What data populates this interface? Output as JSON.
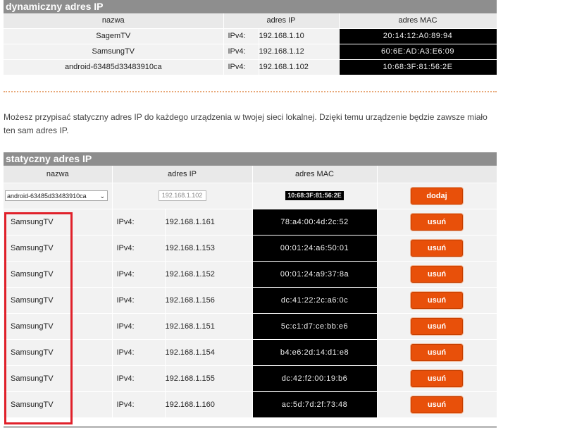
{
  "dynamic": {
    "title": "dynamiczny adres IP",
    "headers": {
      "name": "nazwa",
      "ip": "adres IP",
      "mac": "adres MAC"
    },
    "rows": [
      {
        "name": "SagemTV",
        "proto": "IPv4:",
        "ip": "192.168.1.10",
        "mac": "20:14:12:A0:89:94"
      },
      {
        "name": "SamsungTV",
        "proto": "IPv4:",
        "ip": "192.168.1.12",
        "mac": "60:6E:AD:A3:E6:09"
      },
      {
        "name": "android-63485d33483910ca",
        "proto": "IPv4:",
        "ip": "192.168.1.102",
        "mac": "10:68:3F:81:56:2E"
      }
    ]
  },
  "intro_text": "Możesz przypisać statyczny adres IP do każdego urządzenia w twojej sieci lokalnej. Dzięki temu urządzenie będzie zawsze miało ten sam adres IP.",
  "static": {
    "title": "statyczny adres IP",
    "headers": {
      "name": "nazwa",
      "ip": "adres IP",
      "mac": "adres MAC"
    },
    "add_row": {
      "device_select": "android-63485d33483910ca",
      "ip_value": "192.168.1.102",
      "mac": "10:68:3F:81:56:2E",
      "add_label": "dodaj"
    },
    "remove_label": "usuń",
    "rows": [
      {
        "name": "SamsungTV",
        "proto": "IPv4:",
        "ip": "192.168.1.161",
        "mac": "78:a4:00:4d:2c:52"
      },
      {
        "name": "SamsungTV",
        "proto": "IPv4:",
        "ip": "192.168.1.153",
        "mac": "00:01:24:a6:50:01"
      },
      {
        "name": "SamsungTV",
        "proto": "IPv4:",
        "ip": "192.168.1.152",
        "mac": "00:01:24:a9:37:8a"
      },
      {
        "name": "SamsungTV",
        "proto": "IPv4:",
        "ip": "192.168.1.156",
        "mac": "dc:41:22:2c:a6:0c"
      },
      {
        "name": "SamsungTV",
        "proto": "IPv4:",
        "ip": "192.168.1.151",
        "mac": "5c:c1:d7:ce:bb:e6"
      },
      {
        "name": "SamsungTV",
        "proto": "IPv4:",
        "ip": "192.168.1.154",
        "mac": "b4:e6:2d:14:d1:e8"
      },
      {
        "name": "SamsungTV",
        "proto": "IPv4:",
        "ip": "192.168.1.155",
        "mac": "dc:42:f2:00:19:b6"
      },
      {
        "name": "SamsungTV",
        "proto": "IPv4:",
        "ip": "192.168.1.160",
        "mac": "ac:5d:7d:2f:73:48"
      }
    ]
  },
  "colors": {
    "accent": "#e8500a",
    "header_bar": "#8e8e8e",
    "highlight": "#e0202a"
  }
}
